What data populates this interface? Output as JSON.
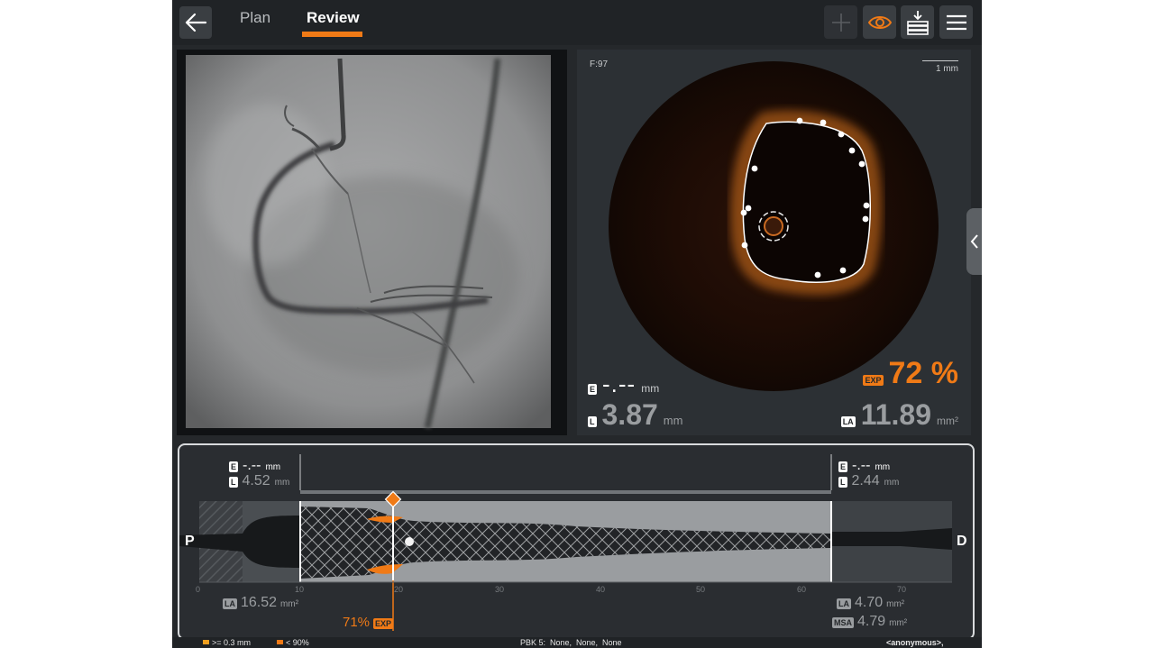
{
  "header": {
    "tabs": [
      {
        "label": "Plan",
        "active": false
      },
      {
        "label": "Review",
        "active": true
      }
    ],
    "accent_color": "#f07a16",
    "toolbar_icons": [
      "back-arrow-icon",
      "plus-icon",
      "eye-icon",
      "download-stack-icon",
      "menu-icon"
    ]
  },
  "oct": {
    "frame_label": "F:97",
    "scale_label": "1 mm",
    "e_badge": "E",
    "e_value": "-.--",
    "e_unit": "mm",
    "l_badge": "L",
    "l_value": "3.87",
    "l_unit": "mm",
    "exp_badge": "EXP",
    "exp_value": "72 %",
    "la_badge": "LA",
    "la_value": "11.89",
    "la_unit": "mm²"
  },
  "longitudinal": {
    "left": {
      "e_badge": "E",
      "e_value": "-.--",
      "e_unit": "mm",
      "l_badge": "L",
      "l_value": "4.52",
      "l_unit": "mm",
      "la_badge": "LA",
      "la_value": "16.52",
      "la_unit": "mm²"
    },
    "right": {
      "e_badge": "E",
      "e_value": "-.--",
      "e_unit": "mm",
      "l_badge": "L",
      "l_value": "2.44",
      "l_unit": "mm",
      "la_badge": "LA",
      "la_value": "4.70",
      "la_unit": "mm²",
      "msa_badge": "MSA",
      "msa_value": "4.79",
      "msa_unit": "mm²"
    },
    "proximal_label": "P",
    "distal_label": "D",
    "axis_ticks": [
      "0",
      "10",
      "20",
      "30",
      "40",
      "50",
      "60",
      "70"
    ],
    "cursor_exp_value": "71%",
    "cursor_exp_badge": "EXP"
  },
  "footer": {
    "legend_1": ">= 0.3 mm",
    "legend_2": "< 90%",
    "status": "PBK 5:  None,  None,  None",
    "user": "<anonymous>,"
  }
}
